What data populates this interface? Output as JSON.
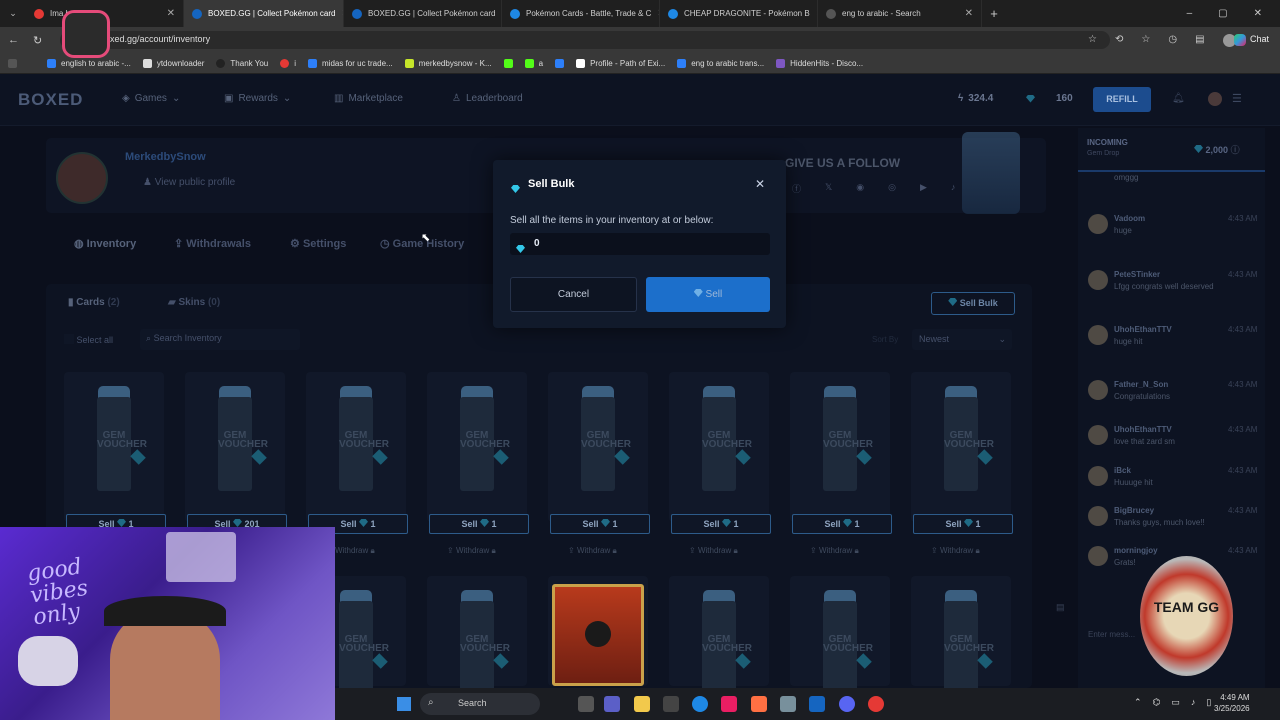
{
  "browser": {
    "tabs": [
      {
        "label": "Ima be...",
        "color": "#e53935"
      },
      {
        "label": "BOXED.GG | Collect Pokémon card",
        "color": "#1565c0",
        "active": true
      },
      {
        "label": "BOXED.GG | Collect Pokémon card",
        "color": "#1565c0"
      },
      {
        "label": "Pokémon Cards - Battle, Trade & C",
        "color": "#1e88e5"
      },
      {
        "label": "CHEAP DRAGONITE - Pokémon B",
        "color": "#1e88e5"
      },
      {
        "label": "eng to arabic - Search",
        "color": "#555"
      }
    ],
    "url": "xed.gg/account/inventory",
    "chat_label": "Chat",
    "bookmarks": [
      "english to arabic -...",
      "ytdownloader",
      "Thank You",
      "i",
      "midas for uc trade...",
      "merkedbysnow - K...",
      "a",
      "eng to arabic trans...",
      "Profile - Path of Exi...",
      "eng to arabic trans...",
      "HiddenHits - Disco..."
    ]
  },
  "site": {
    "logo": "BOXED",
    "nav": [
      "Games",
      "Rewards",
      "Marketplace",
      "Leaderboard"
    ],
    "balance": "324.4",
    "gems": "160",
    "refill": "REFILL"
  },
  "profile": {
    "username": "MerkedbySnow",
    "view_profile": "View public profile",
    "follow": "GIVE US A FOLLOW",
    "tabs": [
      "Inventory",
      "Withdrawals",
      "Settings",
      "Game History"
    ]
  },
  "inventory": {
    "cards_tab": "Cards",
    "cards_count": "(2)",
    "skins_tab": "Skins",
    "skins_count": "(0)",
    "select_all": "Select all",
    "search_placeholder": "Search Inventory",
    "sort_label": "Sort By",
    "sort_value": "Newest",
    "sell_bulk": "Sell Bulk",
    "sell_values": [
      "1",
      "201",
      "1",
      "1",
      "1",
      "1",
      "1",
      "1"
    ],
    "sell_label": "Sell",
    "withdraw_label": "Withdraw"
  },
  "chat": {
    "incoming": "INCOMING",
    "incoming_sub": "Gem Drop",
    "incoming_amount": "2,000",
    "messages": [
      {
        "name": "",
        "text": "omggg",
        "time": ""
      },
      {
        "name": "Vadoom",
        "text": "huge",
        "time": "4:43 AM"
      },
      {
        "name": "PeteSTinker",
        "text": "Lfgg congrats well deserved",
        "time": "4:43 AM"
      },
      {
        "name": "UhohEthanTTV",
        "text": "huge hit",
        "time": "4:43 AM"
      },
      {
        "name": "Father_N_Son",
        "text": "Congratulations",
        "time": "4:43 AM"
      },
      {
        "name": "UhohEthanTTV",
        "text": "love that zard sm",
        "time": "4:43 AM"
      },
      {
        "name": "iBck",
        "text": "Huuuge hit",
        "time": "4:43 AM"
      },
      {
        "name": "BigBrucey",
        "text": "Thanks guys, much love!!",
        "time": "4:43 AM"
      },
      {
        "name": "morningjoy",
        "text": "Grats!",
        "time": "4:43 AM"
      }
    ],
    "input_placeholder": "Enter mess..."
  },
  "modal": {
    "title": "Sell Bulk",
    "description": "Sell all the items in your inventory at or below:",
    "value": "0",
    "cancel": "Cancel",
    "sell": "Sell"
  },
  "webcam": {
    "neon": "good vibes only"
  },
  "coin": "TEAM GG",
  "taskbar": {
    "search": "Search",
    "time": "4:49 AM",
    "date": "3/25/2026"
  }
}
